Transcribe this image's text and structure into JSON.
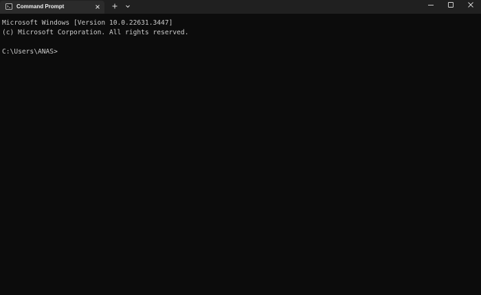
{
  "window": {
    "tab_title": "Command Prompt",
    "icons": {
      "tab": "terminal-icon",
      "tab_close": "close-icon",
      "new_tab": "plus-icon",
      "dropdown": "chevron-down-icon",
      "minimize": "minimize-icon",
      "maximize": "maximize-icon",
      "close": "close-icon"
    }
  },
  "terminal": {
    "lines": [
      "Microsoft Windows [Version 10.0.22631.3447]",
      "(c) Microsoft Corporation. All rights reserved.",
      "",
      "C:\\Users\\ANAS>"
    ]
  },
  "colors": {
    "terminal_bg": "#0c0c0c",
    "titlebar_bg": "#202020",
    "tab_bg": "#2b2b2b",
    "text": "#cccccc"
  }
}
